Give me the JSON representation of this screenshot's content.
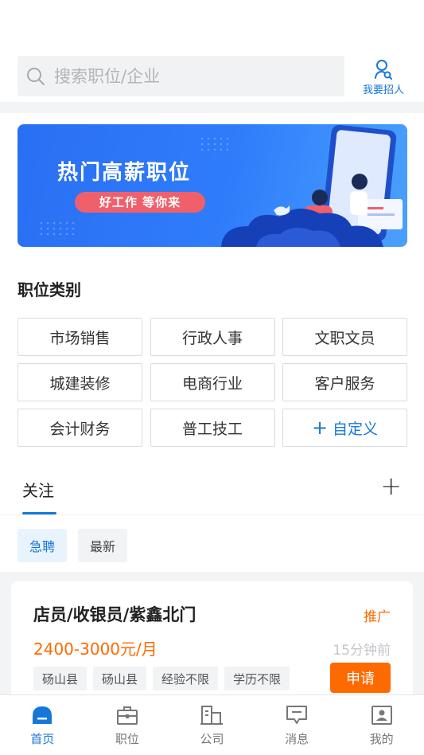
{
  "search": {
    "placeholder": "搜索职位/企业"
  },
  "header": {
    "recruit_label": "我要招人"
  },
  "banner": {
    "title": "热门高薪职位",
    "subtitle": "好工作 等你来"
  },
  "categories": {
    "title": "职位类别",
    "items": [
      "市场销售",
      "行政人事",
      "文职文员",
      "城建装修",
      "电商行业",
      "客户服务",
      "会计财务",
      "普工技工"
    ],
    "custom_label": "自定义"
  },
  "tabs": {
    "follow": "关注",
    "add_symbol": "+"
  },
  "filters": [
    "急聘",
    "最新"
  ],
  "jobs": [
    {
      "title": "店员/收银员/紫鑫北门",
      "promo": "推广",
      "salary": "2400-3000元/月",
      "time": "15分钟前",
      "tags": [
        "砀山县",
        "砀山县",
        "经验不限",
        "学历不限"
      ],
      "apply_label": "申请"
    }
  ],
  "nav": {
    "items": [
      {
        "label": "首页",
        "icon": "home-icon",
        "active": true
      },
      {
        "label": "职位",
        "icon": "briefcase-icon",
        "active": false
      },
      {
        "label": "公司",
        "icon": "building-icon",
        "active": false
      },
      {
        "label": "消息",
        "icon": "message-icon",
        "active": false
      },
      {
        "label": "我的",
        "icon": "profile-icon",
        "active": false
      }
    ]
  },
  "colors": {
    "accent": "#1677d8",
    "orange": "#ff6a00",
    "banner": "#2f7dfb"
  }
}
